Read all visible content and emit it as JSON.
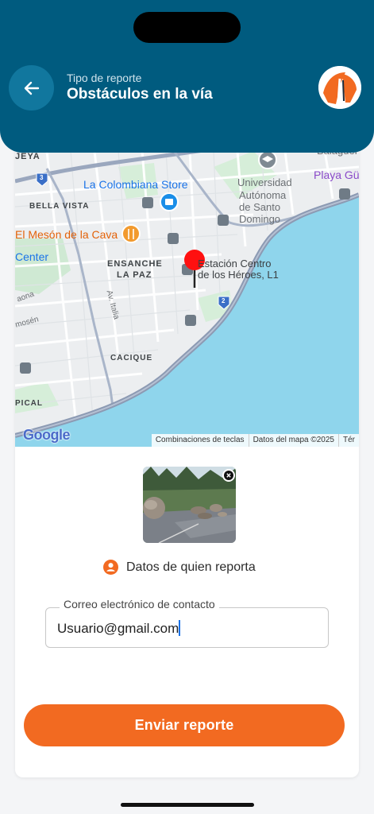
{
  "header": {
    "subtitle": "Tipo de reporte",
    "title": "Obstáculos en la vía",
    "back_icon": "arrow-left-icon",
    "logo_icon": "app-logo-icon"
  },
  "map": {
    "labels": {
      "jeya": "JEYA",
      "balaguer": "Balaguer",
      "colombiana": "La Colombiana Store",
      "bella_vista": "BELLA VISTA",
      "universidad": "Universidad",
      "autonoma": "Autónoma",
      "santo": "de Santo",
      "domingo": "Domingo",
      "playa": "Playa Gü",
      "meson": "El Mesón de la Cava",
      "center": "Center",
      "ensanche": "ENSANCHE",
      "la_paz": "LA PAZ",
      "estacion_1": "Estación Centro",
      "estacion_2": "de los Héroes, L1",
      "aona": "aona",
      "av_italia": "Av. Italia",
      "mosen": "mosén",
      "cacique": "CACIQUE",
      "pical": "PICAL",
      "route_3": "3",
      "route_2": "2"
    },
    "google": "Google",
    "attribution": [
      "Combinaciones de teclas",
      "Datos del mapa ©2025",
      "Tér"
    ]
  },
  "photo": {
    "alt": "Foto de obstáculo en la vía",
    "close_icon": "close-icon"
  },
  "reporter_section": {
    "icon": "user-circle-icon",
    "title": "Datos de quien reporta"
  },
  "email_field": {
    "label": "Correo electrónico de contacto",
    "value": "Usuario@gmail.com"
  },
  "submit_label": "Enviar reporte",
  "colors": {
    "header_bg": "#005b7f",
    "accent_orange": "#f26a21",
    "pin_red": "#ff0000",
    "water": "#8fd5ec"
  }
}
